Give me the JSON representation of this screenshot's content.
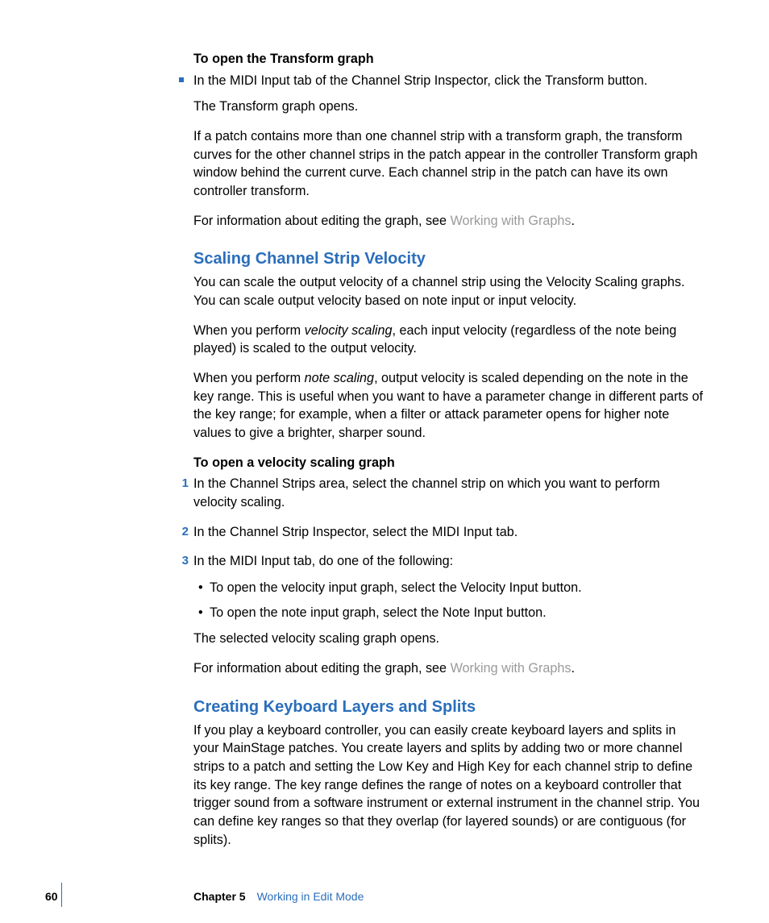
{
  "section1": {
    "heading": "To open the Transform graph",
    "bullet1": "In the MIDI Input tab of the Channel Strip Inspector, click the Transform button.",
    "p1": "The Transform graph opens.",
    "p2": "If a patch contains more than one channel strip with a transform graph, the transform curves for the other channel strips in the patch appear in the controller Transform graph window behind the current curve. Each channel strip in the patch can have its own controller transform.",
    "p3_pre": "For information about editing the graph, see ",
    "p3_link": "Working with Graphs",
    "p3_post": "."
  },
  "section2": {
    "title": "Scaling Channel Strip Velocity",
    "p1": "You can scale the output velocity of a channel strip using the Velocity Scaling graphs. You can scale output velocity based on note input or input velocity.",
    "p2_pre": "When you perform ",
    "p2_em": "velocity scaling",
    "p2_post": ", each input velocity (regardless of the note being played) is scaled to the output velocity.",
    "p3_pre": "When you perform ",
    "p3_em": "note scaling",
    "p3_post": ", output velocity is scaled depending on the note in the key range. This is useful when you want to have a parameter change in different parts of the key range; for example, when a filter or attack parameter opens for higher note values to give a brighter, sharper sound.",
    "sub_heading": "To open a velocity scaling graph",
    "step1": "In the Channel Strips area, select the channel strip on which you want to perform velocity scaling.",
    "step2": "In the Channel Strip Inspector, select the MIDI Input tab.",
    "step3": "In the MIDI Input tab, do one of the following:",
    "sub1": "To open the velocity input graph, select the Velocity Input button.",
    "sub2": "To open the note input graph, select the Note Input button.",
    "p4": "The selected velocity scaling graph opens.",
    "p5_pre": "For information about editing the graph, see ",
    "p5_link": "Working with Graphs",
    "p5_post": "."
  },
  "section3": {
    "title": "Creating Keyboard Layers and Splits",
    "p1": "If you play a keyboard controller, you can easily create keyboard layers and splits in your MainStage patches. You create layers and splits by adding two or more channel strips to a patch and setting the Low Key and High Key for each channel strip to define its key range. The key range defines the range of notes on a keyboard controller that trigger sound from a software instrument or external instrument in the channel strip. You can define key ranges so that they overlap (for layered sounds) or are contiguous (for splits)."
  },
  "footer": {
    "page": "60",
    "chapter": "Chapter 5",
    "title": "Working in Edit Mode"
  },
  "markers": {
    "n1": "1",
    "n2": "2",
    "n3": "3",
    "dot": "•"
  }
}
